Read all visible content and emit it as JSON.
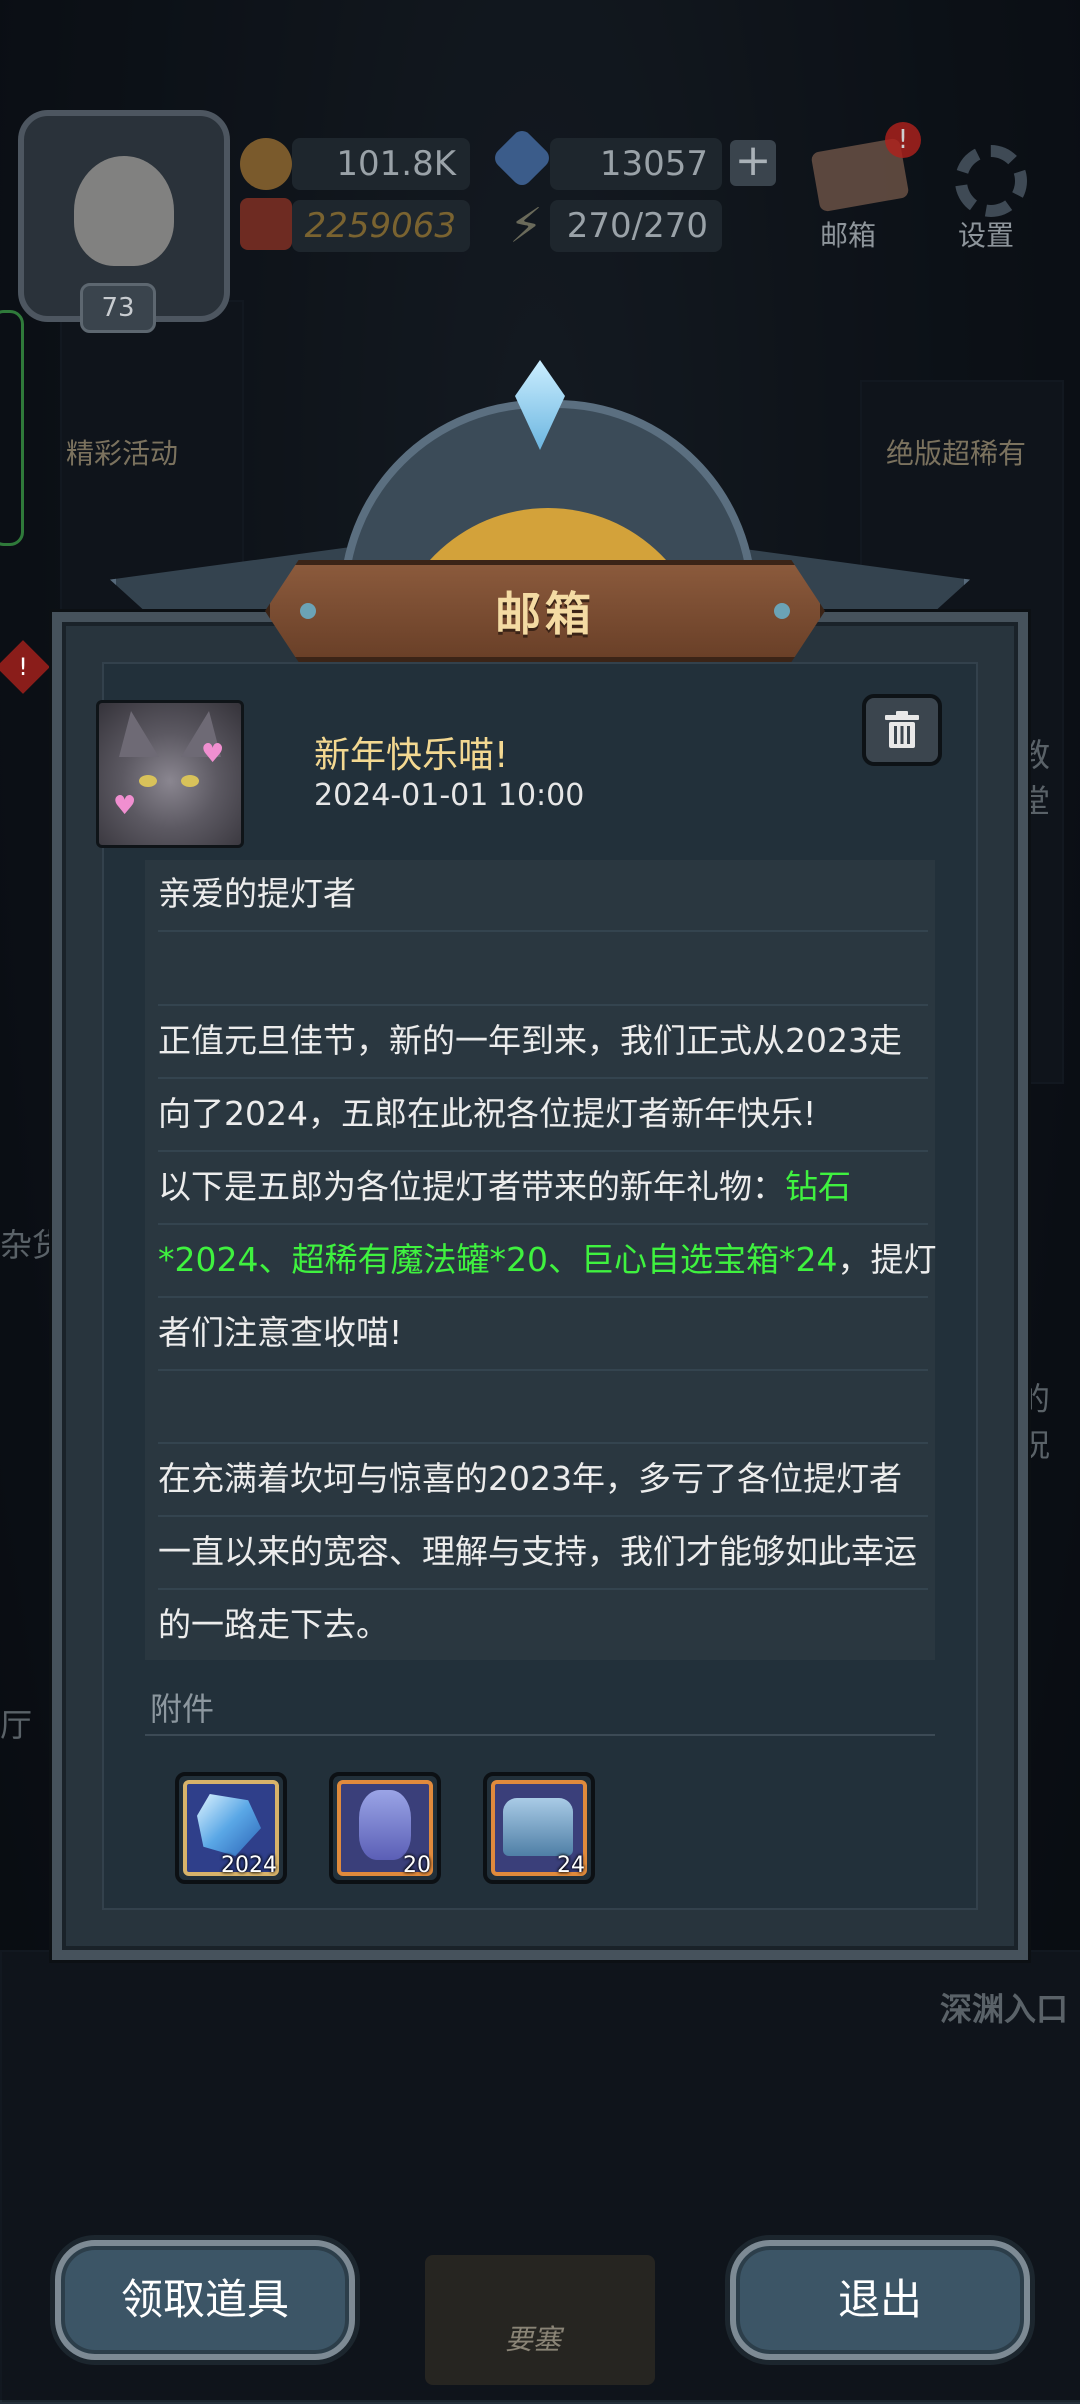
{
  "hud": {
    "level": "73",
    "gold": "101.8K",
    "gems": "13057",
    "power": "2259063",
    "energy": "270/270",
    "mail_label": "邮箱",
    "mail_alert": "!",
    "settings_label": "设置",
    "event_label": "精彩活动",
    "rare_label": "绝版超稀有",
    "left_alert": "!"
  },
  "background": {
    "label_left_1": "杂货",
    "label_left_2": "厅",
    "label_right_1": "教堂",
    "label_right_2": "的祝",
    "label_right_3": "深渊入口"
  },
  "dialog": {
    "title": "邮箱",
    "mail": {
      "subject": "新年快乐喵!",
      "date": "2024-01-01 10:00",
      "lines": [
        {
          "text": "亲爱的提灯者"
        },
        {
          "text": ""
        },
        {
          "text": "正值元旦佳节，新的一年到来，我们正式从2023走"
        },
        {
          "text": "向了2024，五郎在此祝各位提灯者新年快乐!"
        },
        {
          "pre": "以下是五郎为各位提灯者带来的新年礼物：",
          "highlight": "钻石"
        },
        {
          "highlight": "*2024、超稀有魔法罐*20、巨心自选宝箱*24",
          "post": "，提灯"
        },
        {
          "text": "者们注意查收喵!"
        },
        {
          "text": ""
        },
        {
          "text": "在充满着坎坷与惊喜的2023年，多亏了各位提灯者"
        },
        {
          "text": "一直以来的宽容、理解与支持，我们才能够如此幸运"
        },
        {
          "text": "的一路走下去。"
        }
      ],
      "attachments_label": "附件",
      "attachments": [
        {
          "icon": "diamond-icon",
          "count": "2024",
          "border": "#d8b36a"
        },
        {
          "icon": "magic-jar-icon",
          "count": "20",
          "border": "#e08a3c"
        },
        {
          "icon": "chest-icon",
          "count": "24",
          "border": "#e08a3c"
        }
      ]
    }
  },
  "buttons": {
    "claim": "领取道具",
    "exit": "退出",
    "center": "要塞"
  },
  "colors": {
    "highlight_green": "#3ff23f",
    "title_gold": "#f4dba3",
    "subject_yellow": "#f3d891"
  }
}
